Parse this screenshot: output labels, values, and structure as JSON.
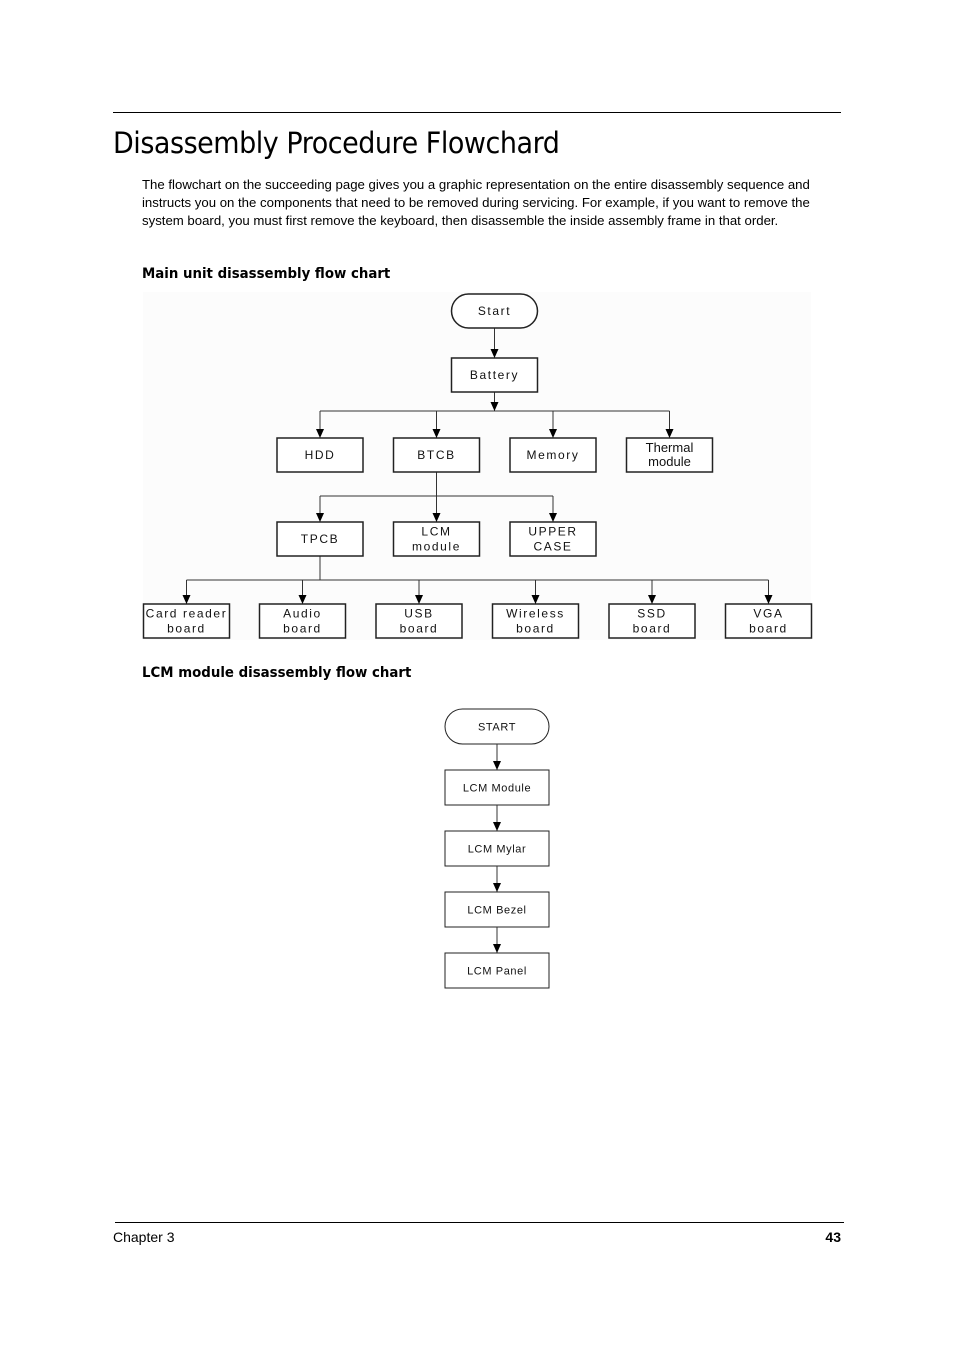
{
  "header": {
    "title": "Disassembly Procedure Flowchard"
  },
  "intro": {
    "text": "The flowchart on the succeeding page gives you a graphic representation on the entire disassembly sequence and instructs you on the components that need to be removed during servicing. For example, if you want to remove the system board, you must first remove the keyboard, then disassemble the inside assembly frame in that order."
  },
  "main_chart": {
    "heading": "Main unit disassembly flow chart",
    "nodes": {
      "start": [
        "Start"
      ],
      "battery": [
        "Battery"
      ],
      "hdd": [
        "HDD"
      ],
      "btcb": [
        "BTCB"
      ],
      "memory": [
        "Memory"
      ],
      "thermal": [
        "Thermal",
        "module"
      ],
      "tpcb": [
        "TPCB"
      ],
      "lcm": [
        "LCM",
        "module"
      ],
      "upper": [
        "UPPER",
        "CASE"
      ],
      "cardreader": [
        "Card reader",
        "board"
      ],
      "audio": [
        "Audio",
        "board"
      ],
      "usb": [
        "USB",
        "board"
      ],
      "wireless": [
        "Wireless",
        "board"
      ],
      "ssd": [
        "SSD",
        "board"
      ],
      "vga": [
        "VGA",
        "board"
      ]
    },
    "edges": [
      [
        "start",
        "battery"
      ],
      [
        "battery",
        "hdd"
      ],
      [
        "battery",
        "btcb"
      ],
      [
        "battery",
        "memory"
      ],
      [
        "battery",
        "thermal"
      ],
      [
        "btcb",
        "tpcb"
      ],
      [
        "btcb",
        "lcm"
      ],
      [
        "btcb",
        "upper"
      ],
      [
        "tpcb",
        "cardreader"
      ],
      [
        "tpcb",
        "audio"
      ],
      [
        "tpcb",
        "usb"
      ],
      [
        "tpcb",
        "wireless"
      ],
      [
        "tpcb",
        "ssd"
      ],
      [
        "tpcb",
        "vga"
      ]
    ]
  },
  "lcm_chart": {
    "heading": "LCM module disassembly flow chart",
    "steps": [
      "START",
      "LCM Module",
      "LCM Mylar",
      "LCM Bezel",
      "LCM Panel"
    ]
  },
  "footer": {
    "chapter": "Chapter 3",
    "page_number": "43"
  }
}
